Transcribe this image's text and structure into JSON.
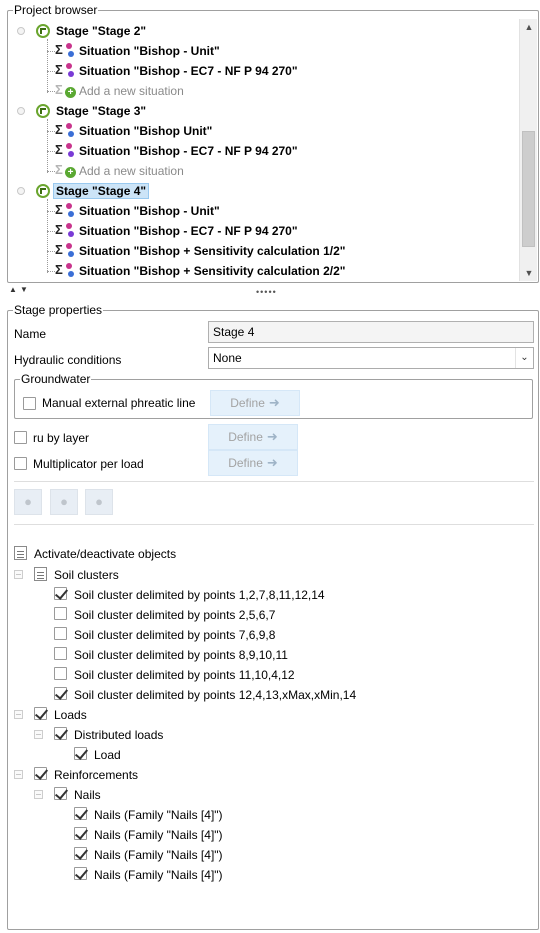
{
  "project_browser": {
    "title": "Project browser",
    "rows": [
      {
        "kind": "stage",
        "label": "Stage \"Stage 2\""
      },
      {
        "kind": "situation",
        "label": "Situation \"Bishop - Unit\"",
        "colors": [
          "#c8348c",
          "#3b6fd6"
        ]
      },
      {
        "kind": "situation",
        "label": "Situation \"Bishop - EC7 - NF P 94 270\"",
        "colors": [
          "#c8348c",
          "#7a3bd6"
        ]
      },
      {
        "kind": "add",
        "label": "Add a new situation"
      },
      {
        "kind": "stage",
        "label": "Stage \"Stage 3\""
      },
      {
        "kind": "situation",
        "label": "Situation \"Bishop Unit\"",
        "colors": [
          "#c8348c",
          "#3b6fd6"
        ]
      },
      {
        "kind": "situation",
        "label": "Situation \"Bishop - EC7 - NF P 94 270\"",
        "colors": [
          "#c8348c",
          "#7a3bd6"
        ]
      },
      {
        "kind": "add",
        "label": "Add a new situation"
      },
      {
        "kind": "stage",
        "label": "Stage \"Stage 4\"",
        "selected": true
      },
      {
        "kind": "situation",
        "label": "Situation \"Bishop - Unit\"",
        "colors": [
          "#c8348c",
          "#3b6fd6"
        ]
      },
      {
        "kind": "situation",
        "label": "Situation \"Bishop - EC7 - NF P 94 270\"",
        "colors": [
          "#c8348c",
          "#7a3bd6"
        ]
      },
      {
        "kind": "situation",
        "label": "Situation \"Bishop + Sensitivity calculation 1/2\"",
        "colors": [
          "#c8348c",
          "#3b6fd6"
        ]
      },
      {
        "kind": "situation",
        "label": "Situation \"Bishop + Sensitivity calculation 2/2\"",
        "colors": [
          "#c8348c",
          "#3b6fd6"
        ]
      }
    ]
  },
  "stage_properties": {
    "title": "Stage properties",
    "name_label": "Name",
    "name_value": "Stage 4",
    "hydraulic_label": "Hydraulic conditions",
    "hydraulic_value": "None",
    "groundwater_title": "Groundwater",
    "manual_phreatic_label": "Manual external phreatic line",
    "ru_by_layer_label": "ru by layer",
    "multiplicator_label": "Multiplicator per load",
    "define_label": "Define",
    "activate_label": "Activate/deactivate objects",
    "tree": [
      {
        "label": "Soil clusters",
        "level": 0,
        "expander": true,
        "icon": "list",
        "checked": null
      },
      {
        "label": "Soil cluster delimited by points 1,2,7,8,11,12,14",
        "level": 1,
        "checked": true
      },
      {
        "label": "Soil cluster delimited by points 2,5,6,7",
        "level": 1,
        "checked": false
      },
      {
        "label": "Soil cluster delimited by points 7,6,9,8",
        "level": 1,
        "checked": false
      },
      {
        "label": "Soil cluster delimited by points 8,9,10,11",
        "level": 1,
        "checked": false
      },
      {
        "label": "Soil cluster delimited by points 11,10,4,12",
        "level": 1,
        "checked": false
      },
      {
        "label": "Soil cluster delimited by points 12,4,13,xMax,xMin,14",
        "level": 1,
        "checked": true
      },
      {
        "label": "Loads",
        "level": 0,
        "expander": true,
        "checked": true
      },
      {
        "label": "Distributed loads",
        "level": 1,
        "expander": true,
        "checked": true
      },
      {
        "label": "Load",
        "level": 2,
        "checked": true
      },
      {
        "label": "Reinforcements",
        "level": 0,
        "expander": true,
        "checked": true
      },
      {
        "label": "Nails",
        "level": 1,
        "expander": true,
        "checked": true
      },
      {
        "label": "Nails (Family \"Nails [4]\")",
        "level": 2,
        "checked": true
      },
      {
        "label": "Nails (Family \"Nails [4]\")",
        "level": 2,
        "checked": true
      },
      {
        "label": "Nails (Family \"Nails [4]\")",
        "level": 2,
        "checked": true
      },
      {
        "label": "Nails (Family \"Nails [4]\")",
        "level": 2,
        "checked": true
      }
    ]
  }
}
